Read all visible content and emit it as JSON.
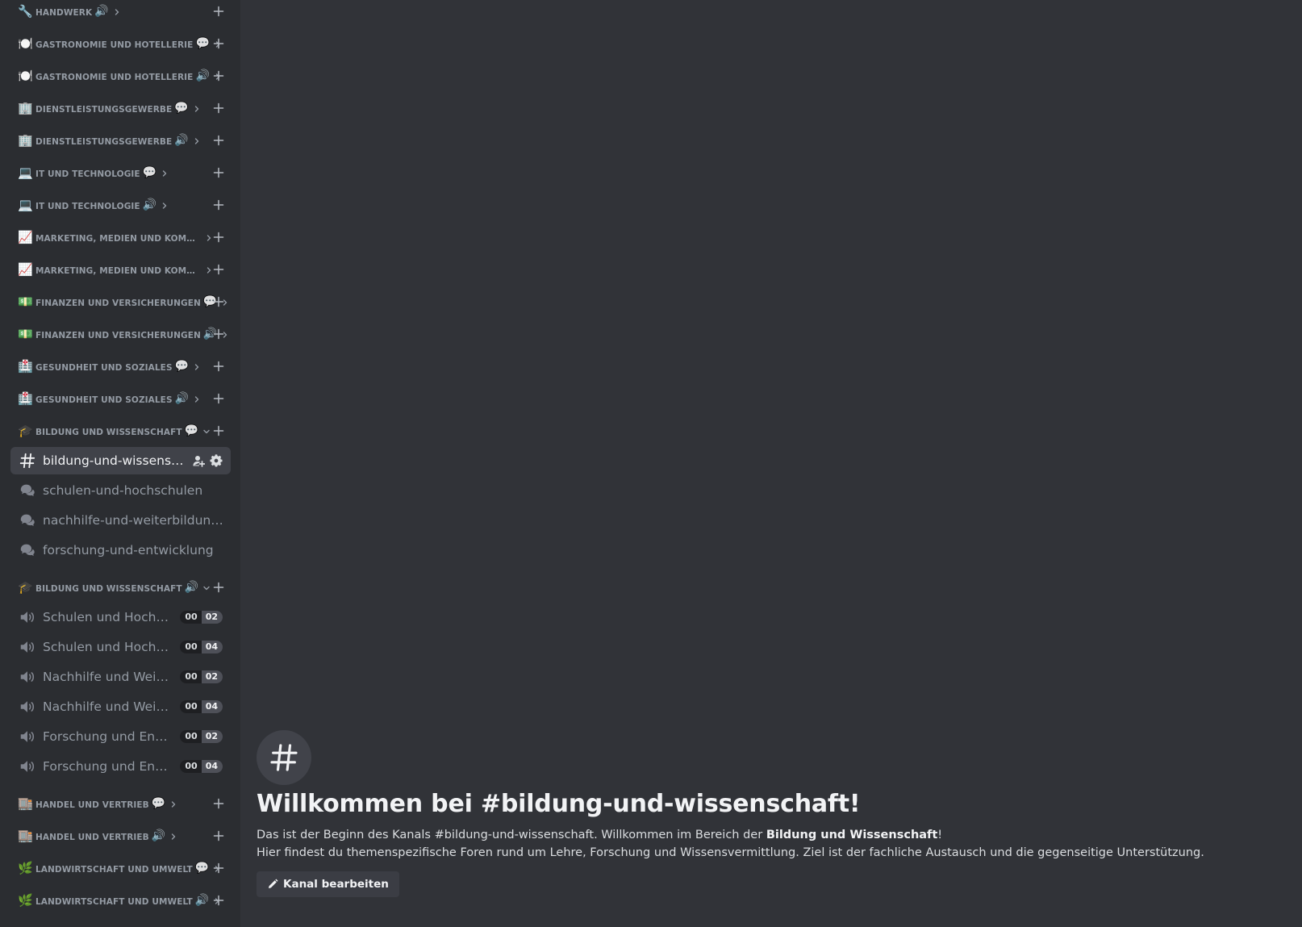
{
  "sidebar": {
    "category_groups": [
      {
        "emoji": "🔧",
        "label": "Handwerk",
        "type_icon": "🔊"
      },
      {
        "emoji": "🍽️",
        "label": "Gastronomie und Hotellerie",
        "type_icon": "💬"
      },
      {
        "emoji": "🍽️",
        "label": "Gastronomie und Hotellerie",
        "type_icon": "🔊"
      },
      {
        "emoji": "🏢",
        "label": "Dienstleistungsgewerbe",
        "type_icon": "💬"
      },
      {
        "emoji": "🏢",
        "label": "Dienstleistungsgewerbe",
        "type_icon": "🔊"
      },
      {
        "emoji": "💻",
        "label": "IT und Technologie",
        "type_icon": "💬"
      },
      {
        "emoji": "💻",
        "label": "IT und Technologie",
        "type_icon": "🔊"
      },
      {
        "emoji": "📈",
        "label": "Marketing, Medien und Kommuni...",
        "type_icon": ""
      },
      {
        "emoji": "📈",
        "label": "Marketing, Medien und Kommuni...",
        "type_icon": ""
      },
      {
        "emoji": "💵",
        "label": "Finanzen und Versicherungen",
        "type_icon": "💬"
      },
      {
        "emoji": "💵",
        "label": "Finanzen und Versicherungen",
        "type_icon": "🔊"
      },
      {
        "emoji": "🏥",
        "label": "Gesundheit und Soziales",
        "type_icon": "💬"
      },
      {
        "emoji": "🏥",
        "label": "Gesundheit und Soziales",
        "type_icon": "🔊"
      }
    ],
    "bildung_text_category": {
      "emoji": "🎓",
      "label": "Bildung und Wissenschaft",
      "type_icon": "💬"
    },
    "active_channel": {
      "label": "bildung-und-wissensch..."
    },
    "forum_channels": [
      {
        "label": "schulen-und-hochschulen"
      },
      {
        "label": "nachhilfe-und-weiterbildungen"
      },
      {
        "label": "forschung-und-entwicklung"
      }
    ],
    "bildung_voice_category": {
      "emoji": "🎓",
      "label": "Bildung und Wissenschaft",
      "type_icon": "🔊"
    },
    "voice_channels": [
      {
        "label": "Schulen und Hochsc...",
        "users": "00",
        "limit": "02"
      },
      {
        "label": "Schulen und Hochsc...",
        "users": "00",
        "limit": "04"
      },
      {
        "label": "Nachhilfe und Weite...",
        "users": "00",
        "limit": "02"
      },
      {
        "label": "Nachhilfe und Weite...",
        "users": "00",
        "limit": "04"
      },
      {
        "label": "Forschung und Entw...",
        "users": "00",
        "limit": "02"
      },
      {
        "label": "Forschung und Entw...",
        "users": "00",
        "limit": "04"
      }
    ],
    "bottom_categories": [
      {
        "emoji": "🏬",
        "label": "Handel und Vertrieb",
        "type_icon": "💬"
      },
      {
        "emoji": "🏬",
        "label": "Handel und Vertrieb",
        "type_icon": "🔊"
      },
      {
        "emoji": "🌿",
        "label": "Landwirtschaft und Umwelt",
        "type_icon": "💬"
      },
      {
        "emoji": "🌿",
        "label": "Landwirtschaft und Umwelt",
        "type_icon": "🔊"
      }
    ]
  },
  "welcome": {
    "title": "Willkommen bei #bildung-und-wissenschaft!",
    "line1_prefix": "Das ist der Beginn des Kanals #bildung-und-wissenschaft. Willkommen im Bereich der ",
    "line1_bold": "Bildung und Wissenschaft",
    "line1_suffix": "!",
    "line2": "Hier findest du themenspezifische Foren rund um Lehre, Forschung und Wissensvermittlung. Ziel ist der fachliche Austausch und die gegenseitige Unterstützung.",
    "edit_button": "Kanal bearbeiten"
  },
  "colors": {
    "sidebar_bg": "#2b2d31",
    "main_bg": "#313338",
    "active_channel_bg": "#404249",
    "muted_text": "#949ba4"
  }
}
